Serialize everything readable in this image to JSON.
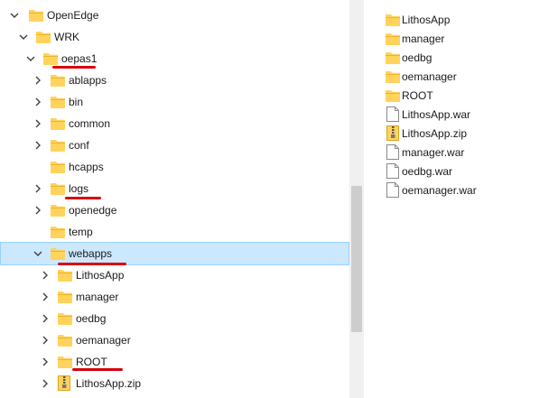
{
  "tree": {
    "items": [
      {
        "label": "OpenEdge",
        "level": 0,
        "expanded": true
      },
      {
        "label": "WRK",
        "level": 1,
        "expanded": true
      },
      {
        "label": "oepas1",
        "level": 2,
        "expanded": true
      },
      {
        "label": "ablapps",
        "level": 3,
        "expanded": false
      },
      {
        "label": "bin",
        "level": 3,
        "expanded": false
      },
      {
        "label": "common",
        "level": 3,
        "expanded": false
      },
      {
        "label": "conf",
        "level": 3,
        "expanded": false
      },
      {
        "label": "hcapps",
        "level": 3,
        "expanded": null
      },
      {
        "label": "logs",
        "level": 3,
        "expanded": false
      },
      {
        "label": "openedge",
        "level": 3,
        "expanded": false
      },
      {
        "label": "temp",
        "level": 3,
        "expanded": null
      },
      {
        "label": "webapps",
        "level": 3,
        "expanded": true,
        "selected": true
      },
      {
        "label": "LithosApp",
        "level": 4,
        "expanded": false
      },
      {
        "label": "manager",
        "level": 4,
        "expanded": false
      },
      {
        "label": "oedbg",
        "level": 4,
        "expanded": false
      },
      {
        "label": "oemanager",
        "level": 4,
        "expanded": false
      },
      {
        "label": "ROOT",
        "level": 4,
        "expanded": false
      },
      {
        "label": "LithosApp.zip",
        "level": 4,
        "expanded": false,
        "type": "zip"
      }
    ]
  },
  "list": {
    "items": [
      {
        "label": "LithosApp",
        "type": "folder"
      },
      {
        "label": "manager",
        "type": "folder"
      },
      {
        "label": "oedbg",
        "type": "folder"
      },
      {
        "label": "oemanager",
        "type": "folder"
      },
      {
        "label": "ROOT",
        "type": "folder"
      },
      {
        "label": "LithosApp.war",
        "type": "file"
      },
      {
        "label": "LithosApp.zip",
        "type": "zip"
      },
      {
        "label": "manager.war",
        "type": "file"
      },
      {
        "label": "oedbg.war",
        "type": "file"
      },
      {
        "label": "oemanager.war",
        "type": "file"
      }
    ]
  },
  "colors": {
    "selection": "#cce8ff",
    "folder": "#ffd35c",
    "annotation": "#d8000c"
  },
  "annotations": {
    "underlined": [
      "oepas1",
      "logs",
      "webapps",
      "ROOT"
    ]
  }
}
